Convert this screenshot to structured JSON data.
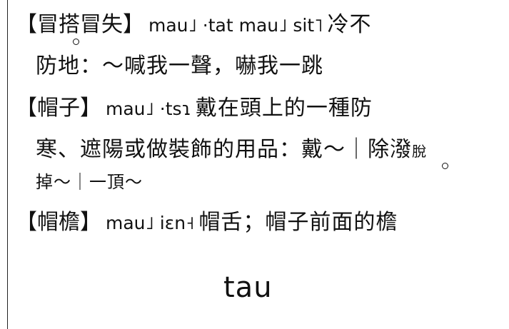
{
  "entries": [
    {
      "headword": "【冒搭冒失】",
      "phonetic": "mau˩ ·tat mau˩ sit˥",
      "definition": "冷不",
      "continuation": "防地：～喊我一聲，嚇我一跳"
    },
    {
      "headword": "【帽子】",
      "phonetic": "mau˩ ·tsɿ",
      "definition": "戴在頭上的一種防",
      "continuation": "寒、遮陽或做裝飾的用品：戴～｜除潑",
      "continuation_small": "脫",
      "continuation2": "掉～｜一頂～"
    },
    {
      "headword": "【帽檐】",
      "phonetic": "mau˩ iɛn˧",
      "definition": "帽舌；帽子前面的檐"
    }
  ],
  "section_heading": "tau"
}
